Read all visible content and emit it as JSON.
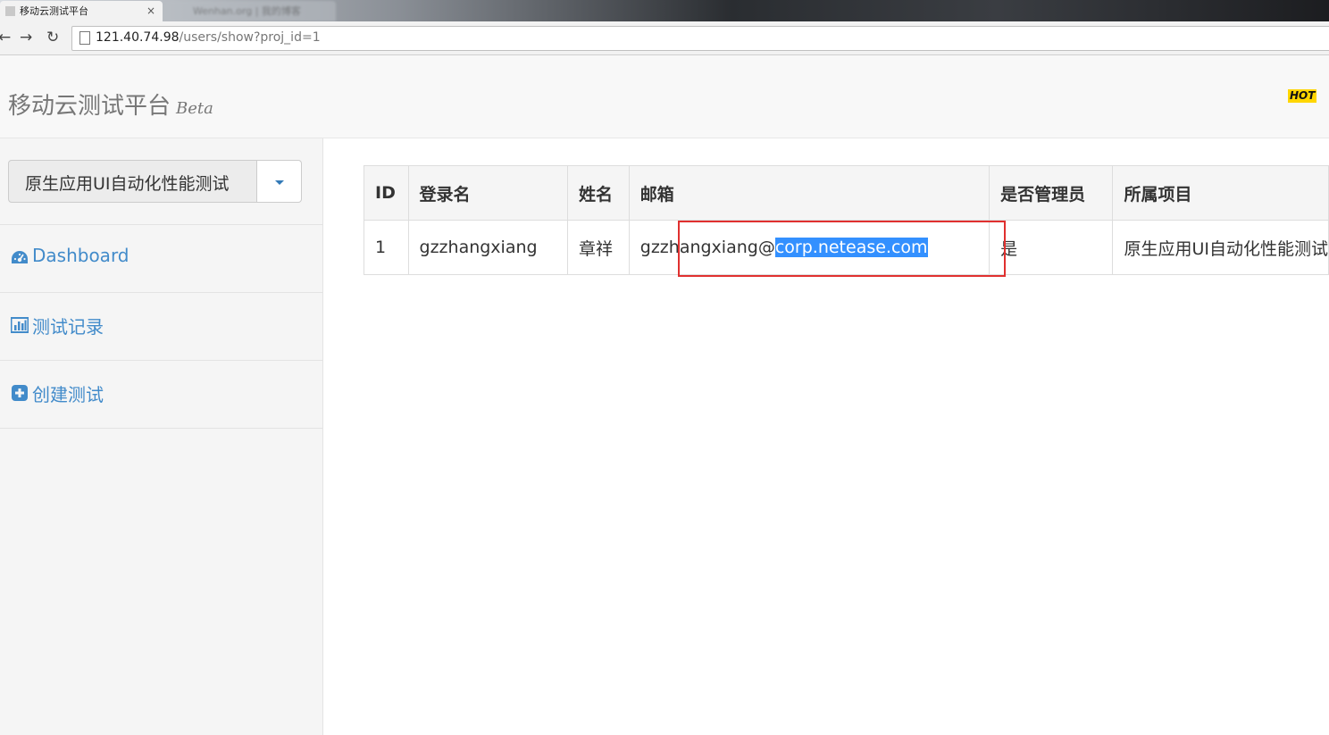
{
  "browser": {
    "active_tab_title": "移动云测试平台",
    "active_tab_close": "×",
    "inactive_tab_title": "Wenhan.org | 我的博客",
    "url_host": "121.40.74.98",
    "url_path": "/users/show?proj_id=1"
  },
  "header": {
    "brand": "移动云测试平台",
    "beta": "Beta",
    "hot": "HOT"
  },
  "sidebar": {
    "project_selected": "原生应用UI自动化性能测试",
    "items": [
      {
        "label": "Dashboard",
        "icon": "dashboard-icon"
      },
      {
        "label": "测试记录",
        "icon": "bar-chart-icon"
      },
      {
        "label": "创建测试",
        "icon": "plus-square-icon"
      }
    ]
  },
  "table": {
    "headers": [
      "ID",
      "登录名",
      "姓名",
      "邮箱",
      "是否管理员",
      "所属项目"
    ],
    "rows": [
      {
        "id": "1",
        "login": "gzzhangxiang",
        "name": "章祥",
        "email_user": "gzzhangxiang@",
        "email_domain": "corp.netease.com",
        "is_admin": "是",
        "project": "原生应用UI自动化性能测试"
      }
    ]
  },
  "colors": {
    "link": "#428bca",
    "selection": "#3390ff",
    "annotation": "#e0302f",
    "hot_badge": "#ffd600"
  }
}
